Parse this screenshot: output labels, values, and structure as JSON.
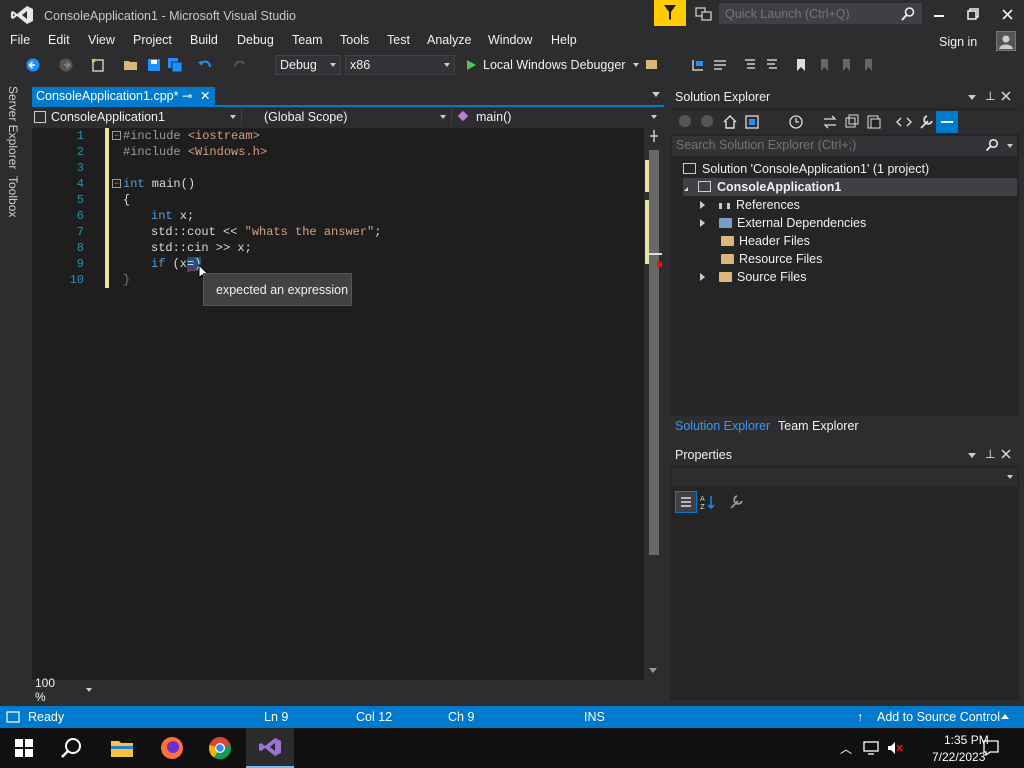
{
  "window": {
    "title": "ConsoleApplication1 - Microsoft Visual Studio",
    "quick_launch_placeholder": "Quick Launch (Ctrl+Q)",
    "sign_in": "Sign in"
  },
  "menu": [
    "File",
    "Edit",
    "View",
    "Project",
    "Build",
    "Debug",
    "Team",
    "Tools",
    "Test",
    "Analyze",
    "Window",
    "Help"
  ],
  "toolbar": {
    "configuration": "Debug",
    "platform": "x86",
    "run_label": "Local Windows Debugger"
  },
  "side_tabs": [
    "Server Explorer",
    "Toolbox"
  ],
  "editor": {
    "tab_label": "ConsoleApplication1.cpp*",
    "nav_project": "ConsoleApplication1",
    "nav_scope": "(Global Scope)",
    "nav_member": "main()",
    "line_numbers": [
      "1",
      "2",
      "3",
      "4",
      "5",
      "6",
      "7",
      "8",
      "9",
      "10"
    ],
    "lines": {
      "l1_pp": "#include ",
      "l1_str": "<iostream>",
      "l2_pp": "#include ",
      "l2_str": "<Windows.h>",
      "l4_kw": "int",
      "l4_rest": " main()",
      "l5": "{",
      "l6_kw": "int",
      "l6_rest": " x;",
      "l7_a": "std::cout << ",
      "l7_str": "\"whats the answer\"",
      "l7_b": ";",
      "l8": "std::cin >> x;",
      "l9_kw": "if",
      "l9_rest": " (x",
      "l9_sel": "=)",
      "l10": "}"
    },
    "tooltip": "expected an expression",
    "zoom": "100 %"
  },
  "solution_explorer": {
    "title": "Solution Explorer",
    "search_placeholder": "Search Solution Explorer (Ctrl+;)",
    "solution": "Solution 'ConsoleApplication1' (1 project)",
    "project": "ConsoleApplication1",
    "items": [
      "References",
      "External Dependencies",
      "Header Files",
      "Resource Files",
      "Source Files"
    ],
    "tab_active": "Solution Explorer",
    "tab_other": "Team Explorer"
  },
  "properties": {
    "title": "Properties"
  },
  "statusbar": {
    "state": "Ready",
    "line": "Ln 9",
    "col": "Col 12",
    "ch": "Ch 9",
    "mode": "INS",
    "source_control": "Add to Source Control"
  },
  "taskbar": {
    "time": "1:35 PM",
    "date": "7/22/2023"
  },
  "colors": {
    "accent": "#007acc",
    "editor_bg": "#1e1e1e",
    "chrome_bg": "#2d2d30",
    "notification": "#ffcc00"
  }
}
